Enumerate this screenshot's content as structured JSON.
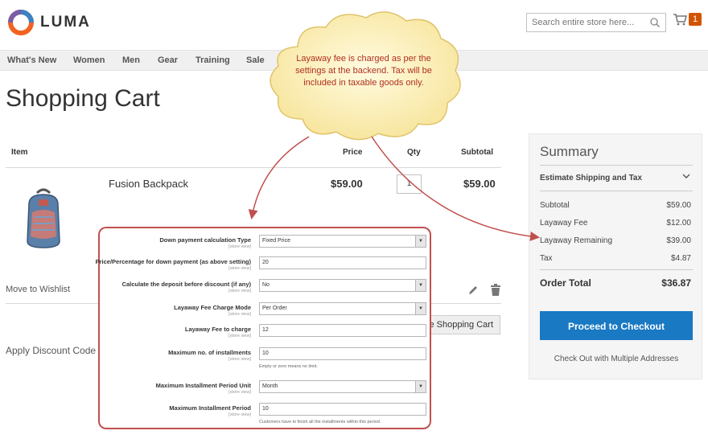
{
  "header": {
    "brand": "LUMA",
    "search_placeholder": "Search entire store here...",
    "cart_count": "1"
  },
  "nav": [
    "What's New",
    "Women",
    "Men",
    "Gear",
    "Training",
    "Sale"
  ],
  "page_title": "Shopping Cart",
  "cart": {
    "columns": {
      "item": "Item",
      "price": "Price",
      "qty": "Qty",
      "subtotal": "Subtotal"
    },
    "product": {
      "name": "Fusion Backpack",
      "price": "$59.00",
      "qty": "1",
      "subtotal": "$59.00"
    },
    "move_to_wishlist": "Move to Wishlist",
    "update_button": "e Shopping Cart",
    "discount": "Apply Discount Code"
  },
  "summary": {
    "title": "Summary",
    "estimate": "Estimate Shipping and Tax",
    "lines": [
      {
        "label": "Subtotal",
        "value": "$59.00"
      },
      {
        "label": "Layaway Fee",
        "value": "$12.00"
      },
      {
        "label": "Layaway Remaining",
        "value": "$39.00"
      },
      {
        "label": "Tax",
        "value": "$4.87"
      }
    ],
    "total_label": "Order Total",
    "total_value": "$36.87",
    "checkout": "Proceed to Checkout",
    "multi": "Check Out with Multiple Addresses"
  },
  "callout": "Layaway fee is charged as per the settings at the backend. Tax will be included in taxable goods only.",
  "config": {
    "scope": "[store view]",
    "rows": [
      {
        "label": "Down payment calculation Type",
        "value": "Fixed Price",
        "type": "select"
      },
      {
        "label": "Price/Percentage for down payment (as above setting)",
        "value": "20",
        "type": "text"
      },
      {
        "label": "Calculate the deposit before discount (if any)",
        "value": "No",
        "type": "select"
      },
      {
        "label": "Layaway Fee Charge Mode",
        "value": "Per Order",
        "type": "select"
      },
      {
        "label": "Layaway Fee to charge",
        "value": "12",
        "type": "text"
      },
      {
        "label": "Maximum no. of installments",
        "value": "10",
        "type": "text",
        "note": "Empty or zero means no limit."
      },
      {
        "label": "Maximum Installment Period Unit",
        "value": "Month",
        "type": "select"
      },
      {
        "label": "Maximum Installment Period",
        "value": "10",
        "type": "text",
        "note": "Customers have to finish all the installments within this period."
      }
    ]
  },
  "colors": {
    "accent": "#1979c3",
    "callout_border": "#c0504d",
    "cart_badge": "#d35400",
    "callout_fill": "#fdf5c4"
  }
}
